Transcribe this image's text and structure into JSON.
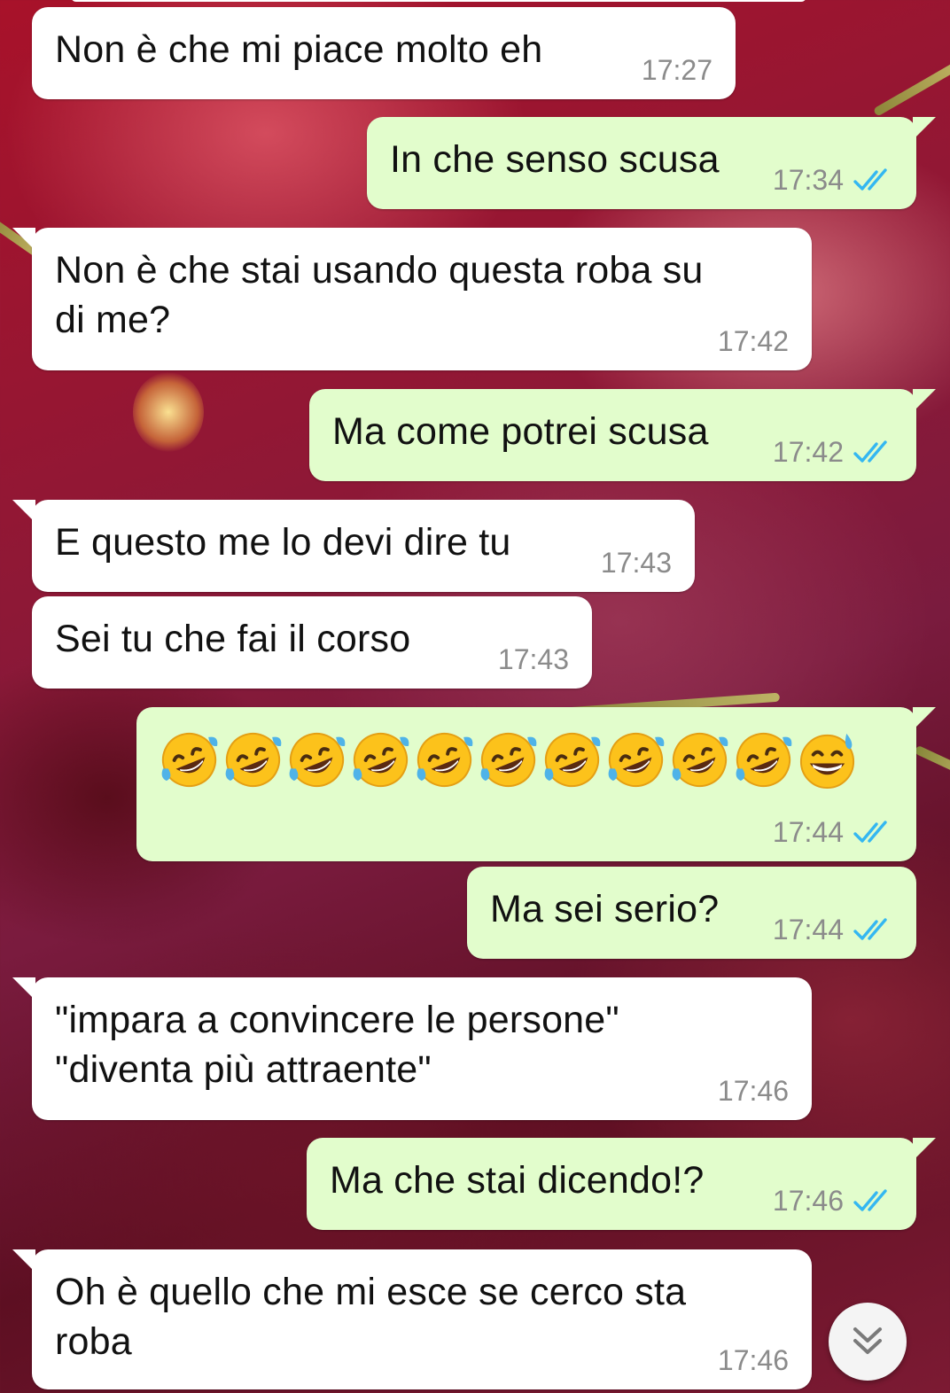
{
  "colors": {
    "incoming_bubble": "#ffffff",
    "outgoing_bubble": "#e2fdcc",
    "timestamp": "#8b8b8b",
    "read_ticks": "#34b7f1",
    "wallpaper": "#8e1836"
  },
  "messages": [
    {
      "direction": "incoming",
      "text": "Non è che mi piace molto eh",
      "time": "17:27"
    },
    {
      "direction": "outgoing",
      "text": "In che senso scusa",
      "time": "17:34",
      "status": "read-double-check-icon"
    },
    {
      "direction": "incoming",
      "text": "Non è che stai usando questa roba su\ndi me?",
      "time": "17:42"
    },
    {
      "direction": "outgoing",
      "text": "Ma come potrei scusa",
      "time": "17:42",
      "status": "read-double-check-icon"
    },
    {
      "direction": "incoming",
      "text": "E questo me lo devi dire tu",
      "time": "17:43"
    },
    {
      "direction": "incoming",
      "text": "Sei tu che fai il corso",
      "time": "17:43"
    },
    {
      "direction": "outgoing",
      "emojis": [
        "rolling-on-floor-laughing",
        "rolling-on-floor-laughing",
        "rolling-on-floor-laughing",
        "rolling-on-floor-laughing",
        "rolling-on-floor-laughing",
        "rolling-on-floor-laughing",
        "rolling-on-floor-laughing",
        "rolling-on-floor-laughing",
        "rolling-on-floor-laughing",
        "rolling-on-floor-laughing",
        "grinning-face-with-sweat"
      ],
      "time": "17:44",
      "status": "read-double-check-icon"
    },
    {
      "direction": "outgoing",
      "text": "Ma sei serio?",
      "time": "17:44",
      "status": "read-double-check-icon"
    },
    {
      "direction": "incoming",
      "text": "\"impara a convincere le persone\"\n\"diventa più attraente\"",
      "time": "17:46"
    },
    {
      "direction": "outgoing",
      "text": "Ma che stai dicendo!?",
      "time": "17:46",
      "status": "read-double-check-icon"
    },
    {
      "direction": "incoming",
      "text": "Oh è quello che mi esce se cerco sta\nroba",
      "time": "17:46"
    }
  ],
  "scroll_button": {
    "icon": "double-chevron-down-icon"
  }
}
